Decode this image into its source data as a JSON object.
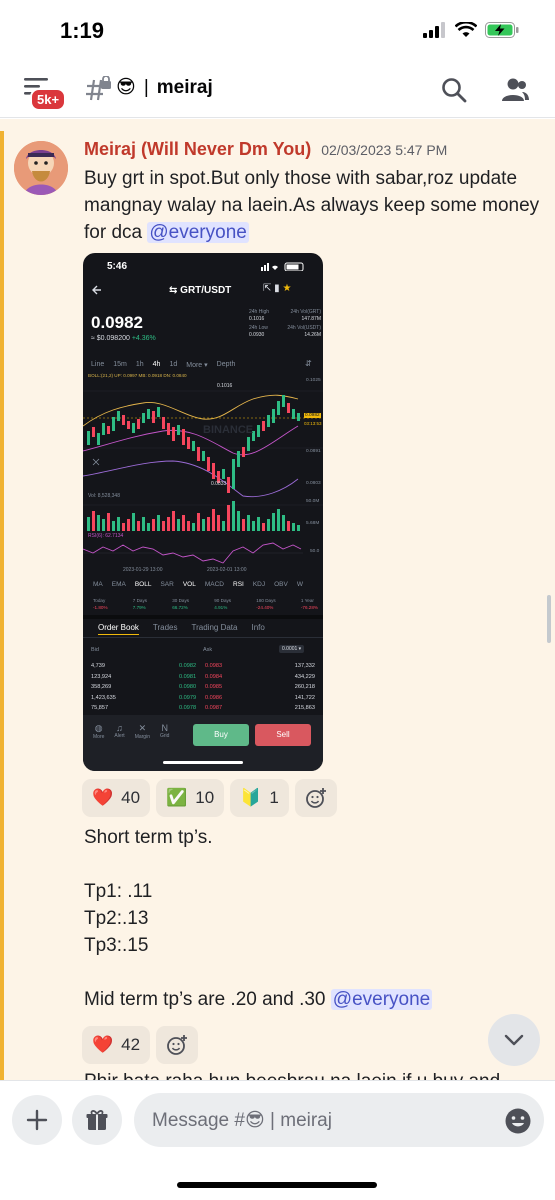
{
  "status_bar": {
    "time": "1:19"
  },
  "header": {
    "badge": "5k+",
    "channel_emoji": "😎",
    "channel_separator": "|",
    "channel_name": "meiraj"
  },
  "message": {
    "author": "Meiraj (Will Never Dm You)",
    "timestamp": "02/03/2023 5:47 PM",
    "text": "Buy grt in spot.But only those with sabar,roz update mangnay walay na laein.As always keep some money for dca",
    "mention": "@everyone"
  },
  "screenshot": {
    "time": "5:46",
    "pair": "GRT/USDT",
    "price": "0.0982",
    "price_usd": "≈ $0.098200",
    "change": "+4.36%",
    "stats": [
      {
        "label": "24h High",
        "value": "0.1016"
      },
      {
        "label": "24h Vol(GRT)",
        "value": "147.87M"
      },
      {
        "label": "24h Low",
        "value": "0.0930"
      },
      {
        "label": "24h Vol(USDT)",
        "value": "14.26M"
      }
    ],
    "intervals": [
      "Line",
      "15m",
      "1h",
      "4h",
      "1d",
      "More ▾",
      "Depth"
    ],
    "boll_line": "BOLL:(21,2)  UP: 0.0997  MB: 0.0918  DN: 0.0840",
    "price_ticks": [
      "0.1025",
      "0.0982",
      "0.0891",
      "0.0803"
    ],
    "chart_marks": {
      "high": "0.1016",
      "low": "0.0833",
      "countdown": "03:13:53"
    },
    "vol_label": "Vol: 8,528,348",
    "vol_ticks": [
      "50.0M",
      "5.68M"
    ],
    "rsi_label": "RSI(6): 62.7134",
    "rsi_tick": "50.0",
    "dates": [
      "2023-01-29 13:00",
      "2023-02-01 13:00"
    ],
    "indicators": [
      "MA",
      "EMA",
      "BOLL",
      "SAR",
      "VOL",
      "MACD",
      "RSI",
      "KDJ",
      "OBV",
      "W"
    ],
    "periods": [
      {
        "label": "Today",
        "value": "-1.80%"
      },
      {
        "label": "7 Days",
        "value": "7.79%"
      },
      {
        "label": "30 Days",
        "value": "66.72%"
      },
      {
        "label": "90 Days",
        "value": "4.91%"
      },
      {
        "label": "180 Days",
        "value": "-24.40%"
      },
      {
        "label": "1 Year",
        "value": "-76.28%"
      }
    ],
    "tabs": [
      "Order Book",
      "Trades",
      "Trading Data",
      "Info"
    ],
    "book_head": {
      "bid": "Bid",
      "ask": "Ask",
      "step": "0.0001 ▾"
    },
    "book": [
      {
        "bid_qty": "4,739",
        "bid": "0.0982",
        "ask": "0.0983",
        "ask_qty": "137,332"
      },
      {
        "bid_qty": "123,924",
        "bid": "0.0981",
        "ask": "0.0984",
        "ask_qty": "434,229"
      },
      {
        "bid_qty": "358,269",
        "bid": "0.0980",
        "ask": "0.0985",
        "ask_qty": "260,218"
      },
      {
        "bid_qty": "1,423,635",
        "bid": "0.0979",
        "ask": "0.0986",
        "ask_qty": "141,722"
      },
      {
        "bid_qty": "75,857",
        "bid": "0.0978",
        "ask": "0.0987",
        "ask_qty": "215,863"
      }
    ],
    "bottom_nav": [
      "More",
      "Alert",
      "Margin",
      "Grid"
    ],
    "buy": "Buy",
    "sell": "Sell"
  },
  "reactions": [
    {
      "emoji": "❤️",
      "count": "40"
    },
    {
      "emoji": "✅",
      "count": "10"
    },
    {
      "emoji": "🔰",
      "count": "1"
    }
  ],
  "followup": {
    "line1": "Short term tp’s.",
    "tp1": "Tp1: .11",
    "tp2": "Tp2:.13",
    "tp3": "Tp3:.15",
    "mid": "Mid term tp’s are .20 and .30",
    "mention": "@everyone"
  },
  "reactions2": [
    {
      "emoji": "❤️",
      "count": "42"
    }
  ],
  "partial_text": "Phir bata raha hun beesbrau na laein if u buy and",
  "composer": {
    "placeholder": "Message #😎 | meiraj"
  },
  "colors": {
    "author": "#c0392b",
    "mention_bg": "#e0e3ff",
    "mention_fg": "#4752c4",
    "highlight": "#fdf4e7",
    "mention_bar": "#f0b232"
  }
}
